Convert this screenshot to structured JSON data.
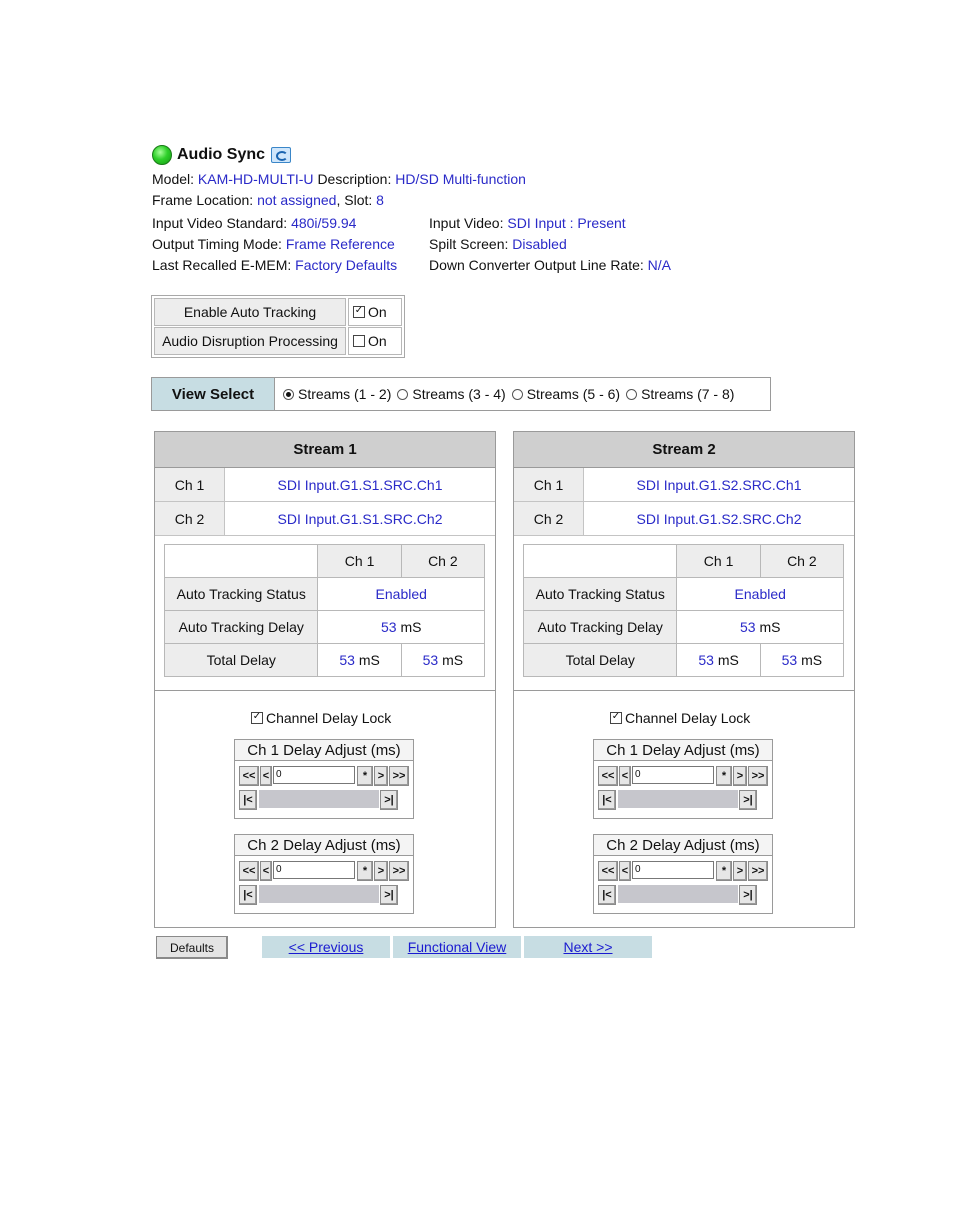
{
  "header": {
    "title": "Audio Sync",
    "model_label": "Model:",
    "model": "KAM-HD-MULTI-U",
    "description_label": "Description:",
    "description": "HD/SD Multi-function",
    "frame_location_label": "Frame Location:",
    "frame_location": "not assigned",
    "slot_label": ", Slot:",
    "slot": "8",
    "input_std_label": "Input Video Standard:",
    "input_std": "480i/59.94",
    "input_video_label": "Input Video:",
    "input_video": "SDI Input : Present",
    "output_timing_label": "Output Timing Mode:",
    "output_timing": "Frame Reference",
    "split_screen_label": "Spilt Screen:",
    "split_screen": "Disabled",
    "last_recalled_label": "Last Recalled E-MEM:",
    "last_recalled": "Factory Defaults",
    "down_conv_label": "Down Converter Output Line Rate:",
    "down_conv": "N/A"
  },
  "tracking": [
    {
      "label": "Enable Auto Tracking",
      "checked": true,
      "value": "On"
    },
    {
      "label": "Audio Disruption Processing",
      "checked": false,
      "value": "On"
    }
  ],
  "view_select": {
    "label": "View Select",
    "options": [
      "Streams (1 - 2)",
      "Streams (3 - 4)",
      "Streams (5 - 6)",
      "Streams (7 - 8)"
    ],
    "selected": 0
  },
  "streams": [
    {
      "title": "Stream 1",
      "channels": [
        {
          "name": "Ch 1",
          "source": "SDI Input.G1.S1.SRC.Ch1"
        },
        {
          "name": "Ch 2",
          "source": "SDI Input.G1.S1.SRC.Ch2"
        }
      ],
      "col_ch1": "Ch 1",
      "col_ch2": "Ch 2",
      "auto_status_label": "Auto Tracking Status",
      "auto_status": "Enabled",
      "auto_delay_label": "Auto Tracking Delay",
      "auto_delay_num": "53",
      "auto_delay_unit": "mS",
      "total_delay_label": "Total Delay",
      "total_ch1_num": "53",
      "total_ch2_num": "53",
      "unit": "mS",
      "lock_label": "Channel Delay Lock",
      "lock_checked": true,
      "adj1_title": "Ch 1 Delay Adjust (ms)",
      "adj1_value": "0",
      "adj2_title": "Ch 2 Delay Adjust (ms)",
      "adj2_value": "0"
    },
    {
      "title": "Stream 2",
      "channels": [
        {
          "name": "Ch 1",
          "source": "SDI Input.G1.S2.SRC.Ch1"
        },
        {
          "name": "Ch 2",
          "source": "SDI Input.G1.S2.SRC.Ch2"
        }
      ],
      "col_ch1": "Ch 1",
      "col_ch2": "Ch 2",
      "auto_status_label": "Auto Tracking Status",
      "auto_status": "Enabled",
      "auto_delay_label": "Auto Tracking Delay",
      "auto_delay_num": "53",
      "auto_delay_unit": "mS",
      "total_delay_label": "Total Delay",
      "total_ch1_num": "53",
      "total_ch2_num": "53",
      "unit": "mS",
      "lock_label": "Channel Delay Lock",
      "lock_checked": true,
      "adj1_title": "Ch 1 Delay Adjust (ms)",
      "adj1_value": "0",
      "adj2_title": "Ch 2 Delay Adjust (ms)",
      "adj2_value": "0"
    }
  ],
  "adjust_buttons": {
    "rewind": "<<",
    "back": "<",
    "star": "*",
    "fwd": ">",
    "ffwd": ">>",
    "home": "|<",
    "end": ">|"
  },
  "footer": {
    "defaults": "Defaults",
    "previous": "<< Previous",
    "functional": "Functional View",
    "next": "Next >>"
  },
  "colors": {
    "link_blue": "#2a2ac8",
    "nav_bg": "#c7dde3",
    "led_green": "#2fd02a"
  }
}
